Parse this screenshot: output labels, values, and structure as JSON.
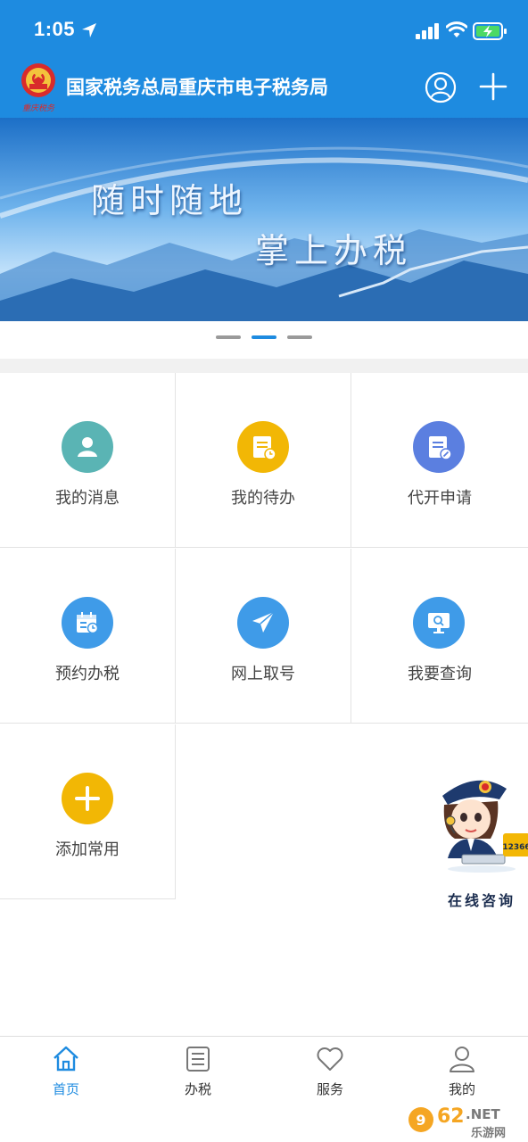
{
  "status_bar": {
    "time": "1:05"
  },
  "header": {
    "title": "国家税务总局重庆市电子税务局",
    "emblem_text": "重庆税务"
  },
  "banner": {
    "line1": "随时随地",
    "line2": "掌上办税",
    "page_count": 3,
    "active_page": 2
  },
  "grid": [
    {
      "label": "我的消息",
      "icon": "user-icon",
      "color": "#5ab4b4"
    },
    {
      "label": "我的待办",
      "icon": "todo-doc-icon",
      "color": "#f2b705"
    },
    {
      "label": "代开申请",
      "icon": "doc-edit-icon",
      "color": "#5b7fe0"
    },
    {
      "label": "预约办税",
      "icon": "calendar-clock-icon",
      "color": "#3f9be8"
    },
    {
      "label": "网上取号",
      "icon": "paper-plane-icon",
      "color": "#3f9be8"
    },
    {
      "label": "我要查询",
      "icon": "monitor-search-icon",
      "color": "#3f9be8"
    },
    {
      "label": "添加常用",
      "icon": "plus-icon",
      "color": "#f2b705"
    }
  ],
  "consult": {
    "label": "在线咨询",
    "badge": "12366"
  },
  "tabbar": [
    {
      "label": "首页",
      "icon": "home-icon",
      "active": true
    },
    {
      "label": "办税",
      "icon": "list-icon",
      "active": false
    },
    {
      "label": "服务",
      "icon": "heart-icon",
      "active": false
    },
    {
      "label": "我的",
      "icon": "person-icon",
      "active": false
    }
  ],
  "watermark": {
    "text": "962.NET",
    "subtext": "乐游网"
  },
  "colors": {
    "primary": "#1e8be0",
    "yellow": "#f2b705",
    "teal": "#5ab4b4",
    "indigo": "#5b7fe0"
  }
}
